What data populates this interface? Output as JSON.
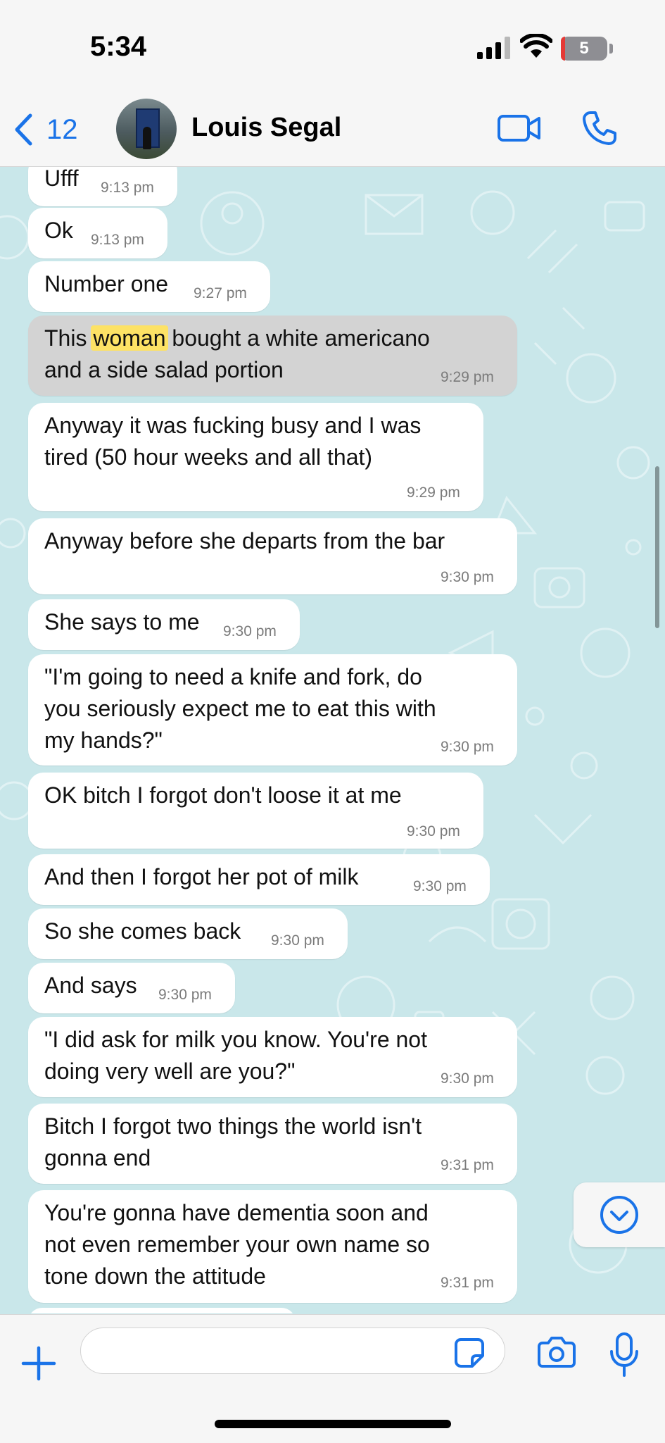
{
  "status": {
    "time": "5:34",
    "battery": "5"
  },
  "header": {
    "back_count": "12",
    "contact_name": "Louis Segal"
  },
  "messages": [
    {
      "text": "Ufff",
      "time": "9:13 pm"
    },
    {
      "text": "Ok",
      "time": "9:13 pm"
    },
    {
      "text": "Number one",
      "time": "9:27 pm"
    },
    {
      "text_before": "This ",
      "highlight": "woman",
      "text_after": " bought a white americano",
      "line2": "and a side salad portion",
      "time": "9:29 pm"
    },
    {
      "text": "Anyway it was fucking busy and I was\ntired (50 hour weeks and all that)",
      "time": "9:29 pm"
    },
    {
      "text": "Anyway before she departs from the bar",
      "time": "9:30 pm"
    },
    {
      "text": "She says to me",
      "time": "9:30 pm"
    },
    {
      "text": "\"I'm going to need a knife and fork, do\nyou seriously expect me to eat this with\nmy hands?\"",
      "time": "9:30 pm"
    },
    {
      "text": "OK bitch I forgot don't loose it at me",
      "time": "9:30 pm"
    },
    {
      "text": "And then I forgot her pot of milk",
      "time": "9:30 pm"
    },
    {
      "text": "So she comes back",
      "time": "9:30 pm"
    },
    {
      "text": "And says",
      "time": "9:30 pm"
    },
    {
      "text": "\"I did ask for milk you know. You're not\ndoing very well are you?\"",
      "time": "9:30 pm"
    },
    {
      "text": "Bitch I forgot two things the world isn't\ngonna end",
      "time": "9:31 pm"
    },
    {
      "text": "You're gonna have dementia soon and\nnot even remember your own name so\ntone down the attitude",
      "time": "9:31 pm"
    }
  ],
  "composer": {
    "value": ""
  },
  "icons": {
    "back": "chevron-left-icon",
    "video": "video-camera-icon",
    "call": "phone-icon",
    "scroll_down": "chevron-down-circle-icon",
    "plus": "plus-icon",
    "sticker": "sticker-icon",
    "camera": "camera-icon",
    "mic": "microphone-icon"
  },
  "colors": {
    "accent": "#1a73e8",
    "highlight": "#fde265",
    "chat_background": "#c9e7ea",
    "highlighted_bubble": "#d3d3d3"
  }
}
